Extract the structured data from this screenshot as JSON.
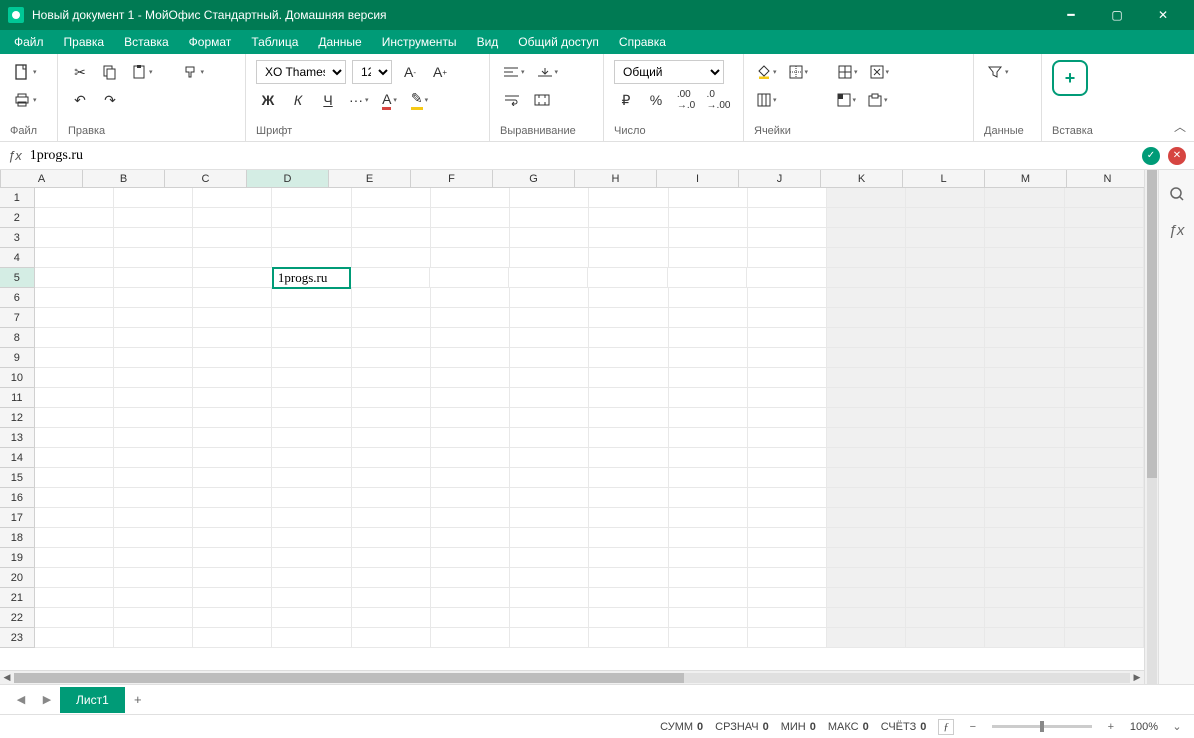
{
  "titlebar": {
    "title": "Новый документ 1 - МойОфис Стандартный. Домашняя версия"
  },
  "menu": [
    "Файл",
    "Правка",
    "Вставка",
    "Формат",
    "Таблица",
    "Данные",
    "Инструменты",
    "Вид",
    "Общий доступ",
    "Справка"
  ],
  "ribbon": {
    "file": "Файл",
    "edit": "Правка",
    "font": "Шрифт",
    "align": "Выравнивание",
    "number": "Число",
    "cells": "Ячейки",
    "data": "Данные",
    "insert": "Вставка",
    "font_name": "XO Thames",
    "font_size": "12",
    "number_format": "Общий",
    "bold": "Ж",
    "italic": "К",
    "underline": "Ч"
  },
  "formula": {
    "value": "1progs.ru"
  },
  "columns": [
    "A",
    "B",
    "C",
    "D",
    "E",
    "F",
    "G",
    "H",
    "I",
    "J",
    "K",
    "L",
    "M",
    "N"
  ],
  "rows": 23,
  "active_cell": {
    "row": 5,
    "col": 3,
    "value": "1progs.ru"
  },
  "inactive_col_start": 10,
  "sheet": {
    "name": "Лист1"
  },
  "status": {
    "sum": "СУММ",
    "sum_v": "0",
    "avg": "СРЗНАЧ",
    "avg_v": "0",
    "min": "МИН",
    "min_v": "0",
    "max": "МАКС",
    "max_v": "0",
    "count": "СЧЁТЗ",
    "count_v": "0",
    "zoom": "100%"
  }
}
